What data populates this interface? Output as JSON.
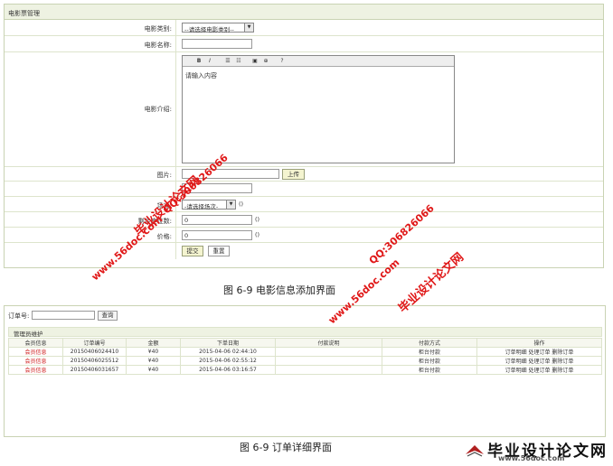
{
  "movie_form": {
    "header": "电影票管理",
    "category_label": "电影类别:",
    "category_select": "--请选择电影类别--",
    "name_label": "电影名称:",
    "intro_label": "电影介绍:",
    "editor_toolbar": {
      "bold": "B",
      "italic": "I"
    },
    "editor_content": "请输入内容",
    "image_label": "图片:",
    "upload_button": "上传",
    "session_label": "场次:",
    "session_select": "-请选择场次-",
    "session_suffix": "()",
    "seats_label": "剩余座位数:",
    "seats_value": "0",
    "seats_suffix": "()",
    "price_label": "价格:",
    "price_value": "0",
    "price_suffix": "()",
    "submit_button": "提交",
    "reset_button": "重置"
  },
  "caption1": "图 6-9 电影信息添加界面",
  "orders": {
    "search_label": "订单号:",
    "search_button": "查询",
    "section_title": "管理员维护",
    "columns": [
      "会员信息",
      "订单编号",
      "金额",
      "下单日期",
      "付款说明",
      "付款方式",
      "操作"
    ],
    "rows": [
      {
        "member": "会员信息",
        "order_no": "20150406024410",
        "amount": "¥40",
        "date": "2015-04-06 02:44:10",
        "note": "",
        "pay": "柜台付款",
        "ops": "订单明细 处理订单 删除订单"
      },
      {
        "member": "会员信息",
        "order_no": "20150406025512",
        "amount": "¥40",
        "date": "2015-04-06 02:55:12",
        "note": "",
        "pay": "柜台付款",
        "ops": "订单明细 处理订单 删除订单"
      },
      {
        "member": "会员信息",
        "order_no": "20150406031657",
        "amount": "¥40",
        "date": "2015-04-06 03:16:57",
        "note": "",
        "pay": "柜台付款",
        "ops": "订单明细 处理订单 删除订单"
      }
    ]
  },
  "caption2": "图 6-9 订单详细界面",
  "watermarks": {
    "site1": "毕业设计论文网",
    "qq1": "QQ:306826066",
    "url1": "www.56doc.com",
    "url2": "www.56doc.com",
    "qq2": "QQ:306826066",
    "site2": "毕业设计论文网"
  },
  "brand": {
    "title": "毕业设计论文网",
    "url": "www.56doc.com"
  },
  "colors": {
    "watermark": "#e01818",
    "header_bg": "#eef2e2",
    "border": "#c9d3b3",
    "member_link": "#d02020"
  }
}
